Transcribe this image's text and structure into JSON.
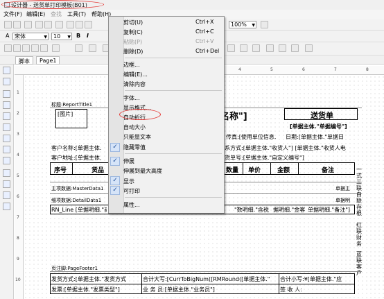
{
  "window": {
    "title": "设计器 - 送货单打印模板(B01)"
  },
  "menubar": {
    "items": [
      "文件(F)",
      "编辑(E)",
      "查找",
      "工具(T)",
      "帮助(H)"
    ]
  },
  "toolbar": {
    "font_name": "宋体",
    "font_size": "10",
    "bold": "B",
    "italic": "I",
    "zoom": "100%"
  },
  "tabs": [
    "脚本",
    "Page1"
  ],
  "ruler": {
    "h_ticks": [
      "4",
      "5",
      "6",
      "7",
      "8"
    ],
    "v_ticks": [
      "1",
      "2",
      "3",
      "4",
      "5",
      "6",
      "7",
      "8",
      "9",
      "10"
    ]
  },
  "report": {
    "title_band": "标题:ReportTitle1",
    "picture": "[图片]",
    "title_text": "名称\"]",
    "doc_title": "送货单",
    "doc_no": "[单据主体.\"单据编号\"]",
    "fax": "传真:[使用单位信息.",
    "date": "日期:[单据主体.\"单据日",
    "customer_name": "客户名称:[单据主体.",
    "contact": "系方式:[单据主体.\"收货人\"] [单据主体.\"收货人电",
    "customer_addr": "客户地址:[单据主体.",
    "bill_no": "货单号:[单据主体.\"自定义编号\"]",
    "col_no": "序号",
    "col_goods": "货品",
    "col_qty": "数量",
    "col_price": "单价",
    "col_amount": "金额",
    "col_remark": "备注",
    "master_band": "主项数据:MasterData1",
    "master_right": "单据主",
    "detail_band": "细项数据:DetailData1",
    "detail_right": "单据明",
    "detail_line": "RN_Line [单据明细.\"商",
    "detail_mid": "\"数明细.\"含税",
    "detail_mid2": "据明细.\"金客",
    "detail_remark": "单据明细.\"备注\"]",
    "right_labels": [
      "一式三联",
      "白联存根",
      "红联财务",
      "蓝联客户"
    ],
    "page_footer_band": "页注脚:PageFooter1",
    "ship_method": "发货方式:[单据主体.\"发货方式",
    "amount_upper": "合计大写:[CurrToBigNum([RMRound([单据主体.\"",
    "amount_lower": "合计小写:¥[单据主体.\"应",
    "invoice": "发票:[单据主体.\"发票类型\"]",
    "salesman": "业 务 员:[单据主体.\"业务员\"]",
    "receiver": "签 收 人:"
  },
  "context_menu": {
    "items": [
      {
        "label": "剪切(U)",
        "shortcut": "Ctrl+X"
      },
      {
        "label": "复制(C)",
        "shortcut": "Ctrl+C"
      },
      {
        "label": "粘贴(P)",
        "shortcut": "Ctrl+V",
        "disabled": true
      },
      {
        "label": "删除(D)",
        "shortcut": "Ctrl+Del"
      },
      {
        "label": "边框..."
      },
      {
        "label": "编辑(E)..."
      },
      {
        "label": "清除内容"
      },
      {
        "label": "字体..."
      },
      {
        "label": "显示格式..."
      },
      {
        "label": "自动折行"
      },
      {
        "label": "自动大小"
      },
      {
        "label": "只能显文本"
      },
      {
        "label": "隐藏零值",
        "checked": true
      },
      {
        "label": "伸展",
        "checked": true
      },
      {
        "label": "伸展到最大高度"
      },
      {
        "label": "显示",
        "checked": true
      },
      {
        "label": "可打印",
        "checked": true
      },
      {
        "label": "属性..."
      }
    ]
  }
}
